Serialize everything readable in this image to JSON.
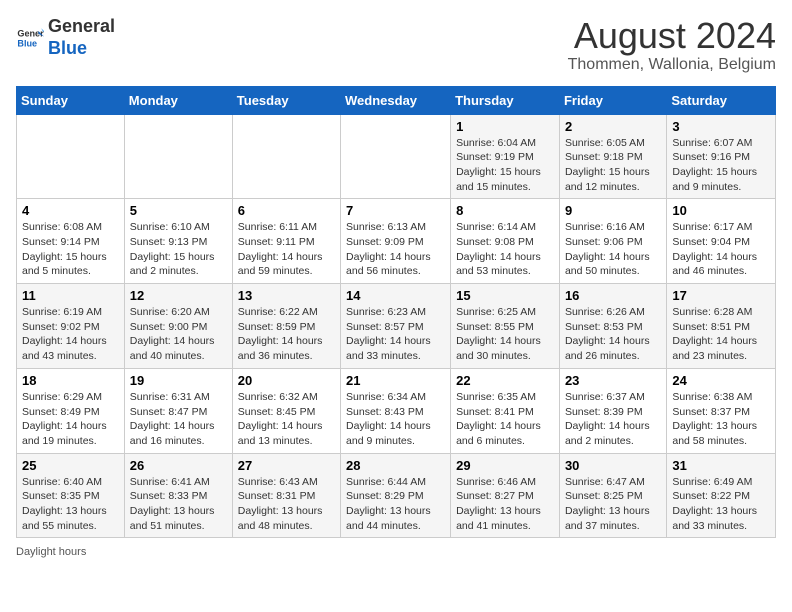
{
  "header": {
    "logo_general": "General",
    "logo_blue": "Blue",
    "main_title": "August 2024",
    "subtitle": "Thommen, Wallonia, Belgium"
  },
  "calendar": {
    "days_of_week": [
      "Sunday",
      "Monday",
      "Tuesday",
      "Wednesday",
      "Thursday",
      "Friday",
      "Saturday"
    ],
    "weeks": [
      [
        {
          "day": "",
          "info": ""
        },
        {
          "day": "",
          "info": ""
        },
        {
          "day": "",
          "info": ""
        },
        {
          "day": "",
          "info": ""
        },
        {
          "day": "1",
          "info": "Sunrise: 6:04 AM\nSunset: 9:19 PM\nDaylight: 15 hours\nand 15 minutes."
        },
        {
          "day": "2",
          "info": "Sunrise: 6:05 AM\nSunset: 9:18 PM\nDaylight: 15 hours\nand 12 minutes."
        },
        {
          "day": "3",
          "info": "Sunrise: 6:07 AM\nSunset: 9:16 PM\nDaylight: 15 hours\nand 9 minutes."
        }
      ],
      [
        {
          "day": "4",
          "info": "Sunrise: 6:08 AM\nSunset: 9:14 PM\nDaylight: 15 hours\nand 5 minutes."
        },
        {
          "day": "5",
          "info": "Sunrise: 6:10 AM\nSunset: 9:13 PM\nDaylight: 15 hours\nand 2 minutes."
        },
        {
          "day": "6",
          "info": "Sunrise: 6:11 AM\nSunset: 9:11 PM\nDaylight: 14 hours\nand 59 minutes."
        },
        {
          "day": "7",
          "info": "Sunrise: 6:13 AM\nSunset: 9:09 PM\nDaylight: 14 hours\nand 56 minutes."
        },
        {
          "day": "8",
          "info": "Sunrise: 6:14 AM\nSunset: 9:08 PM\nDaylight: 14 hours\nand 53 minutes."
        },
        {
          "day": "9",
          "info": "Sunrise: 6:16 AM\nSunset: 9:06 PM\nDaylight: 14 hours\nand 50 minutes."
        },
        {
          "day": "10",
          "info": "Sunrise: 6:17 AM\nSunset: 9:04 PM\nDaylight: 14 hours\nand 46 minutes."
        }
      ],
      [
        {
          "day": "11",
          "info": "Sunrise: 6:19 AM\nSunset: 9:02 PM\nDaylight: 14 hours\nand 43 minutes."
        },
        {
          "day": "12",
          "info": "Sunrise: 6:20 AM\nSunset: 9:00 PM\nDaylight: 14 hours\nand 40 minutes."
        },
        {
          "day": "13",
          "info": "Sunrise: 6:22 AM\nSunset: 8:59 PM\nDaylight: 14 hours\nand 36 minutes."
        },
        {
          "day": "14",
          "info": "Sunrise: 6:23 AM\nSunset: 8:57 PM\nDaylight: 14 hours\nand 33 minutes."
        },
        {
          "day": "15",
          "info": "Sunrise: 6:25 AM\nSunset: 8:55 PM\nDaylight: 14 hours\nand 30 minutes."
        },
        {
          "day": "16",
          "info": "Sunrise: 6:26 AM\nSunset: 8:53 PM\nDaylight: 14 hours\nand 26 minutes."
        },
        {
          "day": "17",
          "info": "Sunrise: 6:28 AM\nSunset: 8:51 PM\nDaylight: 14 hours\nand 23 minutes."
        }
      ],
      [
        {
          "day": "18",
          "info": "Sunrise: 6:29 AM\nSunset: 8:49 PM\nDaylight: 14 hours\nand 19 minutes."
        },
        {
          "day": "19",
          "info": "Sunrise: 6:31 AM\nSunset: 8:47 PM\nDaylight: 14 hours\nand 16 minutes."
        },
        {
          "day": "20",
          "info": "Sunrise: 6:32 AM\nSunset: 8:45 PM\nDaylight: 14 hours\nand 13 minutes."
        },
        {
          "day": "21",
          "info": "Sunrise: 6:34 AM\nSunset: 8:43 PM\nDaylight: 14 hours\nand 9 minutes."
        },
        {
          "day": "22",
          "info": "Sunrise: 6:35 AM\nSunset: 8:41 PM\nDaylight: 14 hours\nand 6 minutes."
        },
        {
          "day": "23",
          "info": "Sunrise: 6:37 AM\nSunset: 8:39 PM\nDaylight: 14 hours\nand 2 minutes."
        },
        {
          "day": "24",
          "info": "Sunrise: 6:38 AM\nSunset: 8:37 PM\nDaylight: 13 hours\nand 58 minutes."
        }
      ],
      [
        {
          "day": "25",
          "info": "Sunrise: 6:40 AM\nSunset: 8:35 PM\nDaylight: 13 hours\nand 55 minutes."
        },
        {
          "day": "26",
          "info": "Sunrise: 6:41 AM\nSunset: 8:33 PM\nDaylight: 13 hours\nand 51 minutes."
        },
        {
          "day": "27",
          "info": "Sunrise: 6:43 AM\nSunset: 8:31 PM\nDaylight: 13 hours\nand 48 minutes."
        },
        {
          "day": "28",
          "info": "Sunrise: 6:44 AM\nSunset: 8:29 PM\nDaylight: 13 hours\nand 44 minutes."
        },
        {
          "day": "29",
          "info": "Sunrise: 6:46 AM\nSunset: 8:27 PM\nDaylight: 13 hours\nand 41 minutes."
        },
        {
          "day": "30",
          "info": "Sunrise: 6:47 AM\nSunset: 8:25 PM\nDaylight: 13 hours\nand 37 minutes."
        },
        {
          "day": "31",
          "info": "Sunrise: 6:49 AM\nSunset: 8:22 PM\nDaylight: 13 hours\nand 33 minutes."
        }
      ]
    ]
  },
  "footer": {
    "note": "Daylight hours"
  }
}
